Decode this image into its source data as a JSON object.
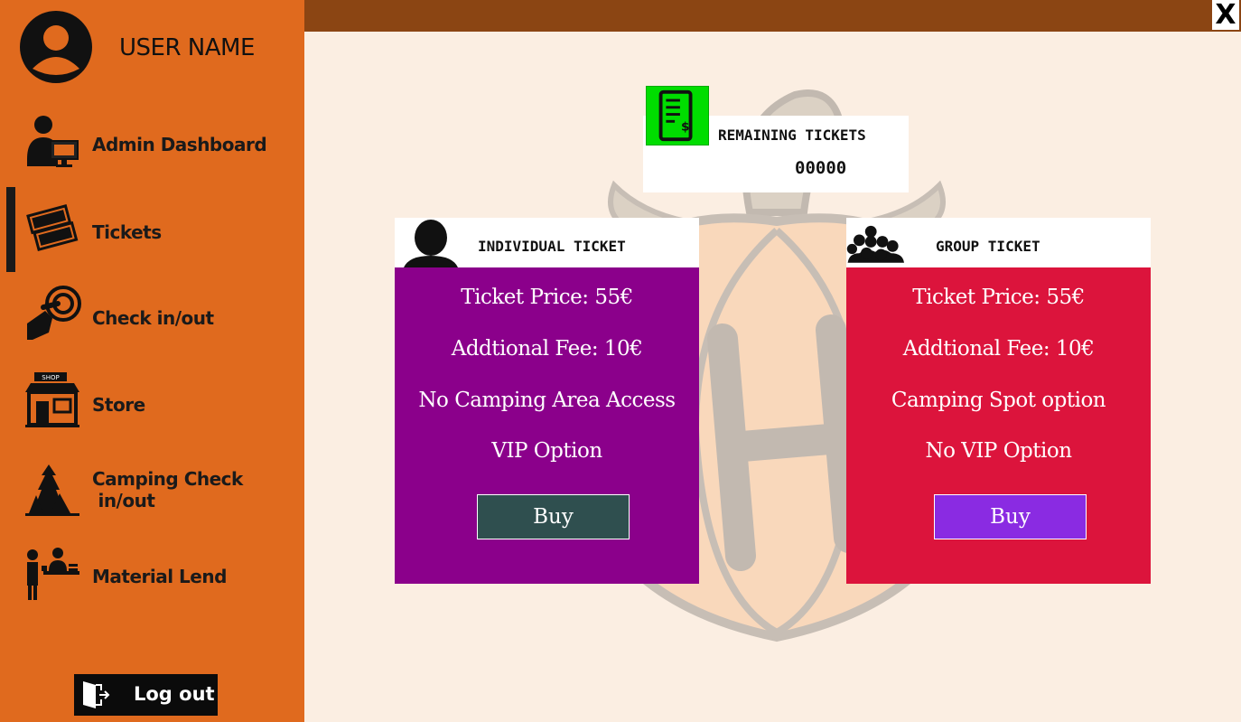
{
  "user": {
    "name": "USER NAME",
    "avatar_icon": "user-circle-icon"
  },
  "sidebar": {
    "items": [
      {
        "label": "Admin Dashboard",
        "icon": "admin-dashboard-icon",
        "active": false
      },
      {
        "label": "Tickets",
        "icon": "tickets-icon",
        "active": true
      },
      {
        "label": "Check in/out",
        "icon": "check-in-hand-icon",
        "active": false
      },
      {
        "label": "Store",
        "icon": "shop-icon",
        "active": false
      },
      {
        "label": "Camping Check\n in/out",
        "icon": "camping-icon",
        "active": false
      },
      {
        "label": "Material Lend",
        "icon": "material-lend-icon",
        "active": false
      }
    ],
    "logout_label": "Log out",
    "logout_icon": "door-exit-icon"
  },
  "window": {
    "close_label": "X"
  },
  "remaining": {
    "title": "REMAINING TICKETS",
    "count": "00000",
    "icon": "receipt-dollar-icon"
  },
  "tickets": {
    "individual": {
      "title": "INDIVIDUAL TICKET",
      "icon": "single-person-icon",
      "lines": [
        "Ticket Price: 55€",
        "Addtional Fee: 10€",
        "No Camping Area Access",
        "VIP Option"
      ],
      "buy_label": "Buy"
    },
    "group": {
      "title": "GROUP TICKET",
      "icon": "group-people-icon",
      "lines": [
        "Ticket Price: 55€",
        "Addtional Fee: 10€",
        "Camping Spot option",
        "No VIP Option"
      ],
      "buy_label": "Buy"
    }
  },
  "colors": {
    "sidebar": "#e06a1e",
    "topbar": "#8b4513",
    "background": "#fbeee2",
    "individual_body": "#8b008b",
    "group_body": "#dc143c",
    "individual_buy": "#2f4f4f",
    "group_buy": "#8a2be2",
    "receipt_icon_bg": "#00dd00"
  },
  "background_logo": {
    "letter": "H"
  }
}
